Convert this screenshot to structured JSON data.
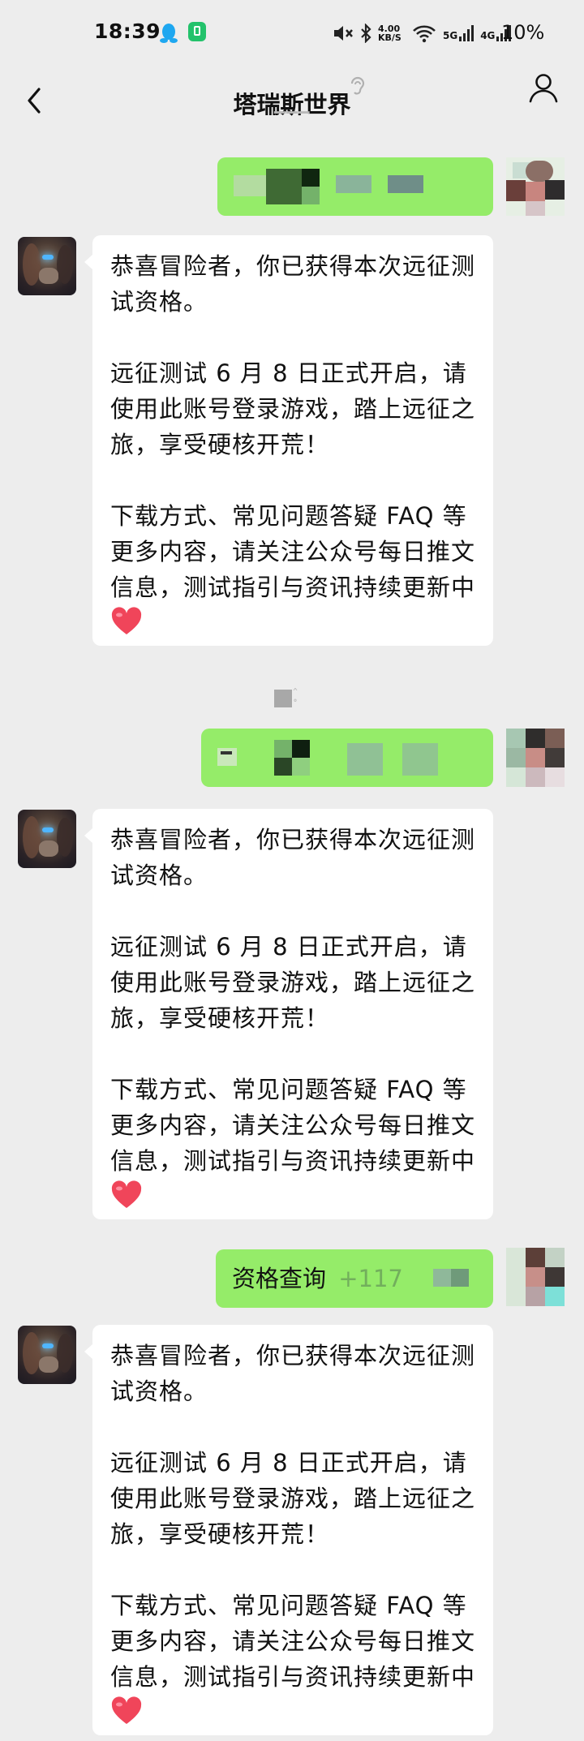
{
  "status_bar": {
    "time": "18:39",
    "net_speed": "4.00 KB/S",
    "signal_1": "5G",
    "signal_2": "4G",
    "battery": "10%"
  },
  "header": {
    "title": "塔瑞斯世界"
  },
  "messages": [
    {
      "from": "user",
      "text": "",
      "blurred": true
    },
    {
      "from": "bot",
      "paragraphs": [
        "恭喜冒险者，你已获得本次远征测试资格。",
        "远征测试 6 月 8 日正式开启，请使用此账号登录游戏，踏上远征之旅，享受硬核开荒！",
        "下载方式、常见问题答疑 FAQ 等更多内容，请关注公众号每日推文信息，测试指引与资讯持续更新中"
      ],
      "emoji": "heart-icon"
    },
    {
      "from": "user",
      "text": "",
      "blurred": true
    },
    {
      "from": "bot",
      "paragraphs": [
        "恭喜冒险者，你已获得本次远征测试资格。",
        "远征测试 6 月 8 日正式开启，请使用此账号登录游戏，踏上远征之旅，享受硬核开荒！",
        "下载方式、常见问题答疑 FAQ 等更多内容，请关注公众号每日推文信息，测试指引与资讯持续更新中"
      ],
      "emoji": "heart-icon"
    },
    {
      "from": "user",
      "text": "资格查询",
      "suffix": "+117",
      "blurred": true
    },
    {
      "from": "bot",
      "paragraphs": [
        "恭喜冒险者，你已获得本次远征测试资格。",
        "远征测试 6 月 8 日正式开启，请使用此账号登录游戏，踏上远征之旅，享受硬核开荒！",
        "下载方式、常见问题答疑 FAQ 等更多内容，请关注公众号每日推文信息，测试指引与资讯持续更新中"
      ],
      "emoji": "heart-icon"
    }
  ],
  "colors": {
    "background": "#ededed",
    "outgoing_bubble": "#95ec69",
    "incoming_bubble": "#ffffff",
    "heart": "#f0455a"
  }
}
